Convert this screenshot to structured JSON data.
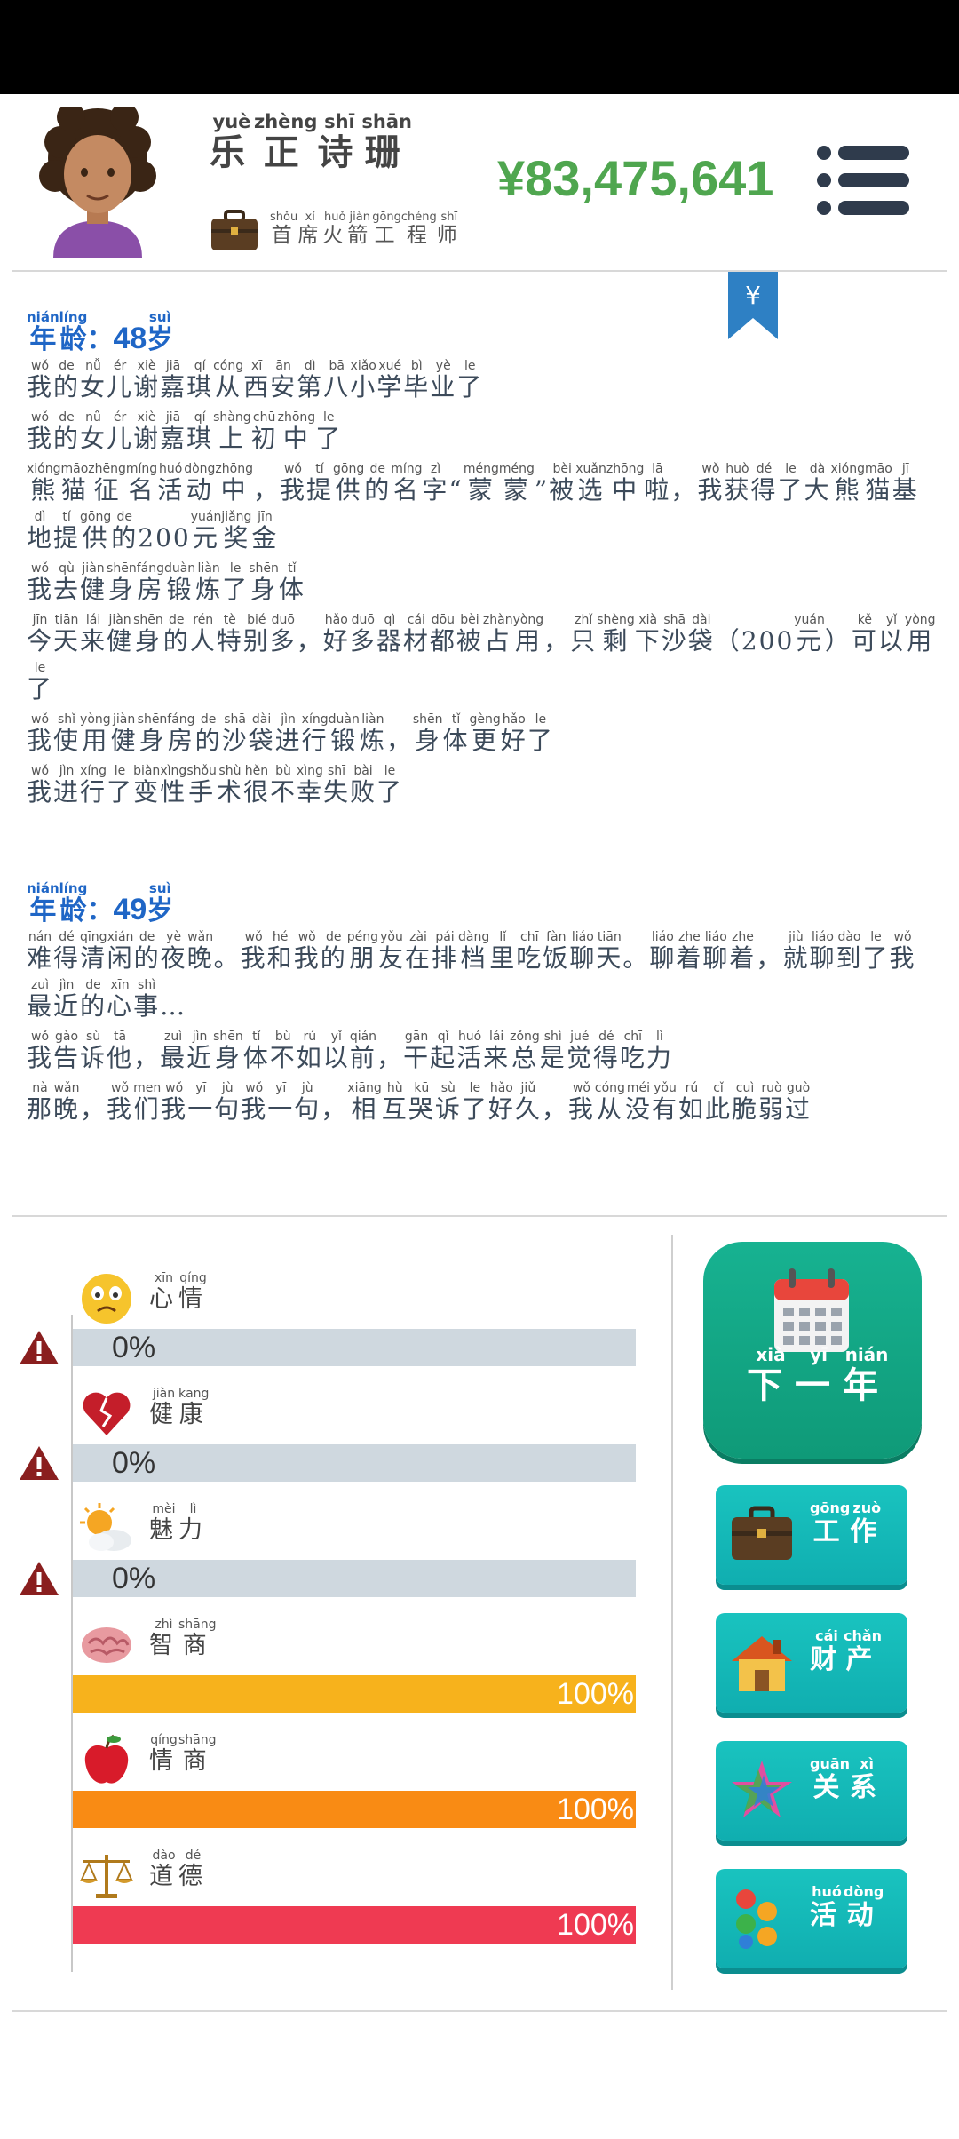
{
  "header": {
    "name": {
      "chars": [
        "乐",
        "正",
        "诗",
        "珊"
      ],
      "pinyin": [
        "yuè",
        "zhèng",
        "shī",
        "shān"
      ]
    },
    "job": {
      "chars": [
        "首",
        "席",
        "火",
        "箭",
        "工",
        "程",
        "师"
      ],
      "pinyin": [
        "shǒu",
        "xí",
        "huǒ",
        "jiàn",
        "gōng",
        "chéng",
        "shī"
      ]
    },
    "money": "¥83,475,641",
    "bookmark_symbol": "¥"
  },
  "story": {
    "years": [
      {
        "age_label": {
          "chars": [
            "年",
            "龄"
          ],
          "pinyin": [
            "nián",
            "líng"
          ]
        },
        "age_num": "48",
        "age_unit": {
          "char": "岁",
          "pinyin": "suì"
        },
        "lines": [
          {
            "chars": [
              "我",
              "的",
              "女",
              "儿",
              "谢",
              "嘉",
              "琪",
              "从",
              "西",
              "安",
              "第",
              "八",
              "小",
              "学",
              "毕",
              "业",
              "了"
            ],
            "pinyin": [
              "wǒ",
              "de",
              "nǚ",
              "ér",
              "xiè",
              "jiā",
              "qí",
              "cóng",
              "xī",
              "ān",
              "dì",
              "bā",
              "xiǎo",
              "xué",
              "bì",
              "yè",
              "le"
            ]
          },
          {
            "chars": [
              "我",
              "的",
              "女",
              "儿",
              "谢",
              "嘉",
              "琪",
              "上",
              "初",
              "中",
              "了"
            ],
            "pinyin": [
              "wǒ",
              "de",
              "nǚ",
              "ér",
              "xiè",
              "jiā",
              "qí",
              "shàng",
              "chū",
              "zhōng",
              "le"
            ]
          },
          {
            "chars": [
              "熊",
              "猫",
              "征",
              "名",
              "活",
              "动",
              "中",
              "，",
              "我",
              "提",
              "供",
              "的",
              "名",
              "字",
              "“",
              "蒙",
              "蒙",
              "”",
              "被",
              "选",
              "中",
              "啦",
              "，",
              "我",
              "获",
              "得",
              "了",
              "大",
              "熊",
              "猫",
              "基",
              "地",
              "提",
              "供",
              "的",
              "200",
              "元",
              "奖",
              "金"
            ],
            "pinyin": [
              "xióng",
              "māo",
              "zhēng",
              "míng",
              "huó",
              "dòng",
              "zhōng",
              "",
              "wǒ",
              "tí",
              "gōng",
              "de",
              "míng",
              "zì",
              "",
              "méng",
              "méng",
              "",
              "bèi",
              "xuǎn",
              "zhōng",
              "lā",
              "",
              "wǒ",
              "huò",
              "dé",
              "le",
              "dà",
              "xióng",
              "māo",
              "jī",
              "dì",
              "tí",
              "gōng",
              "de",
              "",
              "yuán",
              "jiǎng",
              "jīn"
            ]
          },
          {
            "chars": [
              "我",
              "去",
              "健",
              "身",
              "房",
              "锻",
              "炼",
              "了",
              "身",
              "体"
            ],
            "pinyin": [
              "wǒ",
              "qù",
              "jiàn",
              "shēn",
              "fáng",
              "duàn",
              "liàn",
              "le",
              "shēn",
              "tǐ"
            ]
          },
          {
            "chars": [
              "今",
              "天",
              "来",
              "健",
              "身",
              "的",
              "人",
              "特",
              "别",
              "多",
              "，",
              "好",
              "多",
              "器",
              "材",
              "都",
              "被",
              "占",
              "用",
              "，",
              "只",
              "剩",
              "下",
              "沙",
              "袋",
              "（",
              "200",
              "元",
              "）",
              "可",
              "以",
              "用",
              "了"
            ],
            "pinyin": [
              "jīn",
              "tiān",
              "lái",
              "jiàn",
              "shēn",
              "de",
              "rén",
              "tè",
              "bié",
              "duō",
              "",
              "hǎo",
              "duō",
              "qì",
              "cái",
              "dōu",
              "bèi",
              "zhàn",
              "yòng",
              "",
              "zhǐ",
              "shèng",
              "xià",
              "shā",
              "dài",
              "",
              "",
              "yuán",
              "",
              "kě",
              "yǐ",
              "yòng",
              "le"
            ]
          },
          {
            "chars": [
              "我",
              "使",
              "用",
              "健",
              "身",
              "房",
              "的",
              "沙",
              "袋",
              "进",
              "行",
              "锻",
              "炼",
              "，",
              "身",
              "体",
              "更",
              "好",
              "了"
            ],
            "pinyin": [
              "wǒ",
              "shǐ",
              "yòng",
              "jiàn",
              "shēn",
              "fáng",
              "de",
              "shā",
              "dài",
              "jìn",
              "xíng",
              "duàn",
              "liàn",
              "",
              "shēn",
              "tǐ",
              "gèng",
              "hǎo",
              "le"
            ]
          },
          {
            "chars": [
              "我",
              "进",
              "行",
              "了",
              "变",
              "性",
              "手",
              "术",
              "很",
              "不",
              "幸",
              "失",
              "败",
              "了"
            ],
            "pinyin": [
              "wǒ",
              "jìn",
              "xíng",
              "le",
              "biàn",
              "xìng",
              "shǒu",
              "shù",
              "hěn",
              "bù",
              "xìng",
              "shī",
              "bài",
              "le"
            ]
          }
        ]
      },
      {
        "age_label": {
          "chars": [
            "年",
            "龄"
          ],
          "pinyin": [
            "nián",
            "líng"
          ]
        },
        "age_num": "49",
        "age_unit": {
          "char": "岁",
          "pinyin": "suì"
        },
        "lines": [
          {
            "chars": [
              "难",
              "得",
              "清",
              "闲",
              "的",
              "夜",
              "晚",
              "。",
              "我",
              "和",
              "我",
              "的",
              "朋",
              "友",
              "在",
              "排",
              "档",
              "里",
              "吃",
              "饭",
              "聊",
              "天",
              "。",
              "聊",
              "着",
              "聊",
              "着",
              "，",
              "就",
              "聊",
              "到",
              "了",
              "我",
              "最",
              "近",
              "的",
              "心",
              "事",
              "…"
            ],
            "pinyin": [
              "nán",
              "dé",
              "qīng",
              "xián",
              "de",
              "yè",
              "wǎn",
              "",
              "wǒ",
              "hé",
              "wǒ",
              "de",
              "péng",
              "yǒu",
              "zài",
              "pái",
              "dàng",
              "lǐ",
              "chī",
              "fàn",
              "liáo",
              "tiān",
              "",
              "liáo",
              "zhe",
              "liáo",
              "zhe",
              "",
              "jiù",
              "liáo",
              "dào",
              "le",
              "wǒ",
              "zuì",
              "jìn",
              "de",
              "xīn",
              "shì",
              ""
            ]
          },
          {
            "chars": [
              "我",
              "告",
              "诉",
              "他",
              "，",
              "最",
              "近",
              "身",
              "体",
              "不",
              "如",
              "以",
              "前",
              "，",
              "干",
              "起",
              "活",
              "来",
              "总",
              "是",
              "觉",
              "得",
              "吃",
              "力"
            ],
            "pinyin": [
              "wǒ",
              "gào",
              "sù",
              "tā",
              "",
              "zuì",
              "jìn",
              "shēn",
              "tǐ",
              "bù",
              "rú",
              "yǐ",
              "qián",
              "",
              "gān",
              "qǐ",
              "huó",
              "lái",
              "zǒng",
              "shì",
              "jué",
              "dé",
              "chī",
              "lì"
            ]
          },
          {
            "chars": [
              "那",
              "晚",
              "，",
              "我",
              "们",
              "我",
              "一",
              "句",
              "我",
              "一",
              "句",
              "，",
              "相",
              "互",
              "哭",
              "诉",
              "了",
              "好",
              "久",
              "，",
              "我",
              "从",
              "没",
              "有",
              "如",
              "此",
              "脆",
              "弱",
              "过"
            ],
            "pinyin": [
              "nà",
              "wǎn",
              "",
              "wǒ",
              "men",
              "wǒ",
              "yī",
              "jù",
              "wǒ",
              "yī",
              "jù",
              "",
              "xiāng",
              "hù",
              "kū",
              "sù",
              "le",
              "hǎo",
              "jiǔ",
              "",
              "wǒ",
              "cóng",
              "méi",
              "yǒu",
              "rú",
              "cǐ",
              "cuì",
              "ruò",
              "guò"
            ]
          }
        ]
      }
    ]
  },
  "stats": [
    {
      "key": "mood",
      "icon": "sad-face-icon",
      "chars": [
        "心",
        "情"
      ],
      "pinyin": [
        "xīn",
        "qíng"
      ],
      "value": 0,
      "value_text": "0%",
      "color": "#cfd8df",
      "warning": true
    },
    {
      "key": "health",
      "icon": "broken-heart-icon",
      "chars": [
        "健",
        "康"
      ],
      "pinyin": [
        "jiàn",
        "kāng"
      ],
      "value": 0,
      "value_text": "0%",
      "color": "#cfd8df",
      "warning": true
    },
    {
      "key": "charm",
      "icon": "sun-cloud-icon",
      "chars": [
        "魅",
        "力"
      ],
      "pinyin": [
        "mèi",
        "lì"
      ],
      "value": 0,
      "value_text": "0%",
      "color": "#cfd8df",
      "warning": true
    },
    {
      "key": "iq",
      "icon": "brain-icon",
      "chars": [
        "智",
        "商"
      ],
      "pinyin": [
        "zhì",
        "shāng"
      ],
      "value": 1,
      "value_text": "100%",
      "color": "#f7b21c",
      "warning": false
    },
    {
      "key": "eq",
      "icon": "apple-icon",
      "chars": [
        "情",
        "商"
      ],
      "pinyin": [
        "qíng",
        "shāng"
      ],
      "value": 1,
      "value_text": "100%",
      "color": "#f98b14",
      "warning": false
    },
    {
      "key": "morality",
      "icon": "scales-icon",
      "chars": [
        "道",
        "德"
      ],
      "pinyin": [
        "dào",
        "dé"
      ],
      "value": 1,
      "value_text": "100%",
      "color": "#ef3a52",
      "warning": false
    }
  ],
  "buttons": {
    "next_year": {
      "chars": [
        "下",
        "一",
        "年"
      ],
      "pinyin": [
        "xià",
        "yī",
        "nián"
      ],
      "icon": "calendar-icon"
    },
    "side": [
      {
        "key": "work",
        "chars": [
          "工",
          "作"
        ],
        "pinyin": [
          "gōng",
          "zuò"
        ],
        "icon": "briefcase-icon"
      },
      {
        "key": "assets",
        "chars": [
          "财",
          "产"
        ],
        "pinyin": [
          "cái",
          "chǎn"
        ],
        "icon": "house-icon"
      },
      {
        "key": "relations",
        "chars": [
          "关",
          "系"
        ],
        "pinyin": [
          "guān",
          "xì"
        ],
        "icon": "stars-icon"
      },
      {
        "key": "activities",
        "chars": [
          "活",
          "动"
        ],
        "pinyin": [
          "huó",
          "dòng"
        ],
        "icon": "dots-icon"
      }
    ]
  },
  "colors": {
    "money": "#4fa64f",
    "age": "#1f66c6",
    "next_year": "#12a886",
    "side_button": "#14b8b8",
    "menu": "#2f3b4c"
  }
}
